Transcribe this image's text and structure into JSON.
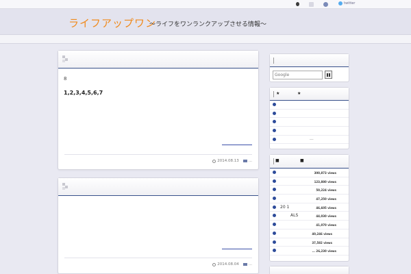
{
  "topbar": {
    "icons": [
      "person-icon",
      "page-icon",
      "rss-icon"
    ],
    "twitter_label": "twitter"
  },
  "header": {
    "title": "ライフアップワン",
    "tagline": "～ライフをワンランクアップさせる情報～"
  },
  "posts": [
    {
      "excerpt": "8",
      "numbers": "1,2,3,4,5,6,7",
      "date": "2014.08.13",
      "category": "..."
    },
    {
      "excerpt": "",
      "numbers": "",
      "date": "2014.08.04",
      "category": "..."
    }
  ],
  "sidebar": {
    "search": {
      "placeholder": "Google"
    },
    "recommend": {
      "title_left": "★",
      "title_right": "★",
      "items": [
        "",
        "",
        "",
        "",
        "..."
      ]
    },
    "popular": {
      "title_left": "■",
      "title_right": "■",
      "items": [
        {
          "label": "",
          "views": "300,873 views"
        },
        {
          "label": "",
          "views": "123,880 views"
        },
        {
          "label": "",
          "views": "50,224 views"
        },
        {
          "label": "",
          "views": "47,250 views"
        },
        {
          "label": "20  1",
          "views": "46,605 views"
        },
        {
          "label": "ALS",
          "views": "44,030 views"
        },
        {
          "label": "",
          "views": "41,070 views"
        },
        {
          "label": "",
          "views": "40,246 views"
        },
        {
          "label": "",
          "views": "37,582 views"
        },
        {
          "label": "",
          "views": "... 26,230 views"
        }
      ]
    }
  },
  "colors": {
    "title": "#f08a1c",
    "accent": "#37508a",
    "bullet": "#2d4b9a",
    "background": "#e9e9f2"
  }
}
